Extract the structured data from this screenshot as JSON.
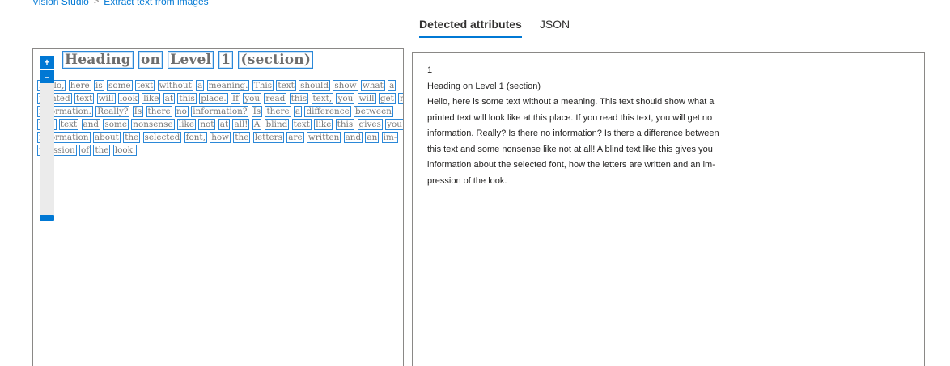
{
  "breadcrumb": {
    "items": [
      "Vision Studio",
      "Extract text from images"
    ],
    "separator": ">"
  },
  "tabs": [
    {
      "label": "Detected attributes",
      "active": true
    },
    {
      "label": "JSON",
      "active": false
    }
  ],
  "image_panel": {
    "zoom_in_label": "+",
    "zoom_out_label": "–",
    "heading_words": [
      "Heading",
      "on",
      "Level",
      "1",
      "(section)"
    ],
    "lines": [
      [
        "Hello,",
        "here",
        "is",
        "some",
        "text",
        "without",
        "a",
        "meaning.",
        "This",
        "text",
        "should",
        "show",
        "what",
        "a"
      ],
      [
        "printed",
        "text",
        "will",
        "look",
        "like",
        "at",
        "this",
        "place.",
        "If",
        "you",
        "read",
        "this",
        "text,",
        "you",
        "will",
        "get",
        "no"
      ],
      [
        "information.",
        "Really?",
        "Is",
        "there",
        "no",
        "information?",
        "Is",
        "there",
        "a",
        "difference",
        "between"
      ],
      [
        "this",
        "text",
        "and",
        "some",
        "nonsense",
        "like",
        "not",
        "at",
        "all!",
        "A",
        "blind",
        "text",
        "like",
        "this",
        "gives",
        "you"
      ],
      [
        "information",
        "about",
        "the",
        "selected",
        "font,",
        "how",
        "the",
        "letters",
        "are",
        "written",
        "and",
        "an",
        "im-"
      ],
      [
        "pression",
        "of",
        "the",
        "look."
      ]
    ]
  },
  "result_panel": {
    "lines": [
      "1",
      "Heading on Level 1 (section)",
      "Hello, here is some text without a meaning. This text should show what a",
      "printed text will look like at this place. If you read this text, you will get no",
      "information. Really? Is there no information? Is there a difference between",
      "this text and some nonsense like not at all! A blind text like this gives you",
      "information about the selected font, how the letters are written and an im-",
      "pression of the look."
    ]
  },
  "colors": {
    "accent": "#0078d4",
    "bounding_box": "#2b88d8"
  }
}
